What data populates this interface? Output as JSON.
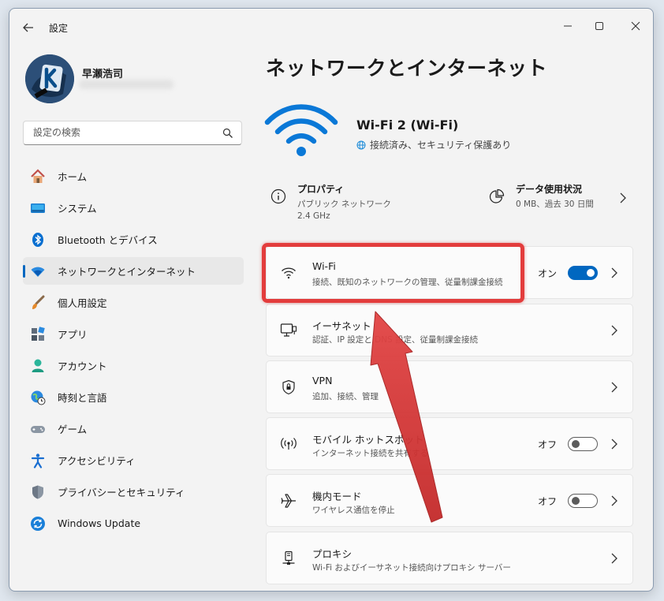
{
  "window": {
    "title": "設定"
  },
  "user": {
    "name": "早瀬浩司"
  },
  "search": {
    "placeholder": "設定の検索"
  },
  "sidebar": {
    "items": [
      {
        "label": "ホーム",
        "icon": "home-icon"
      },
      {
        "label": "システム",
        "icon": "system-icon"
      },
      {
        "label": "Bluetooth とデバイス",
        "icon": "bluetooth-icon"
      },
      {
        "label": "ネットワークとインターネット",
        "icon": "network-icon",
        "active": true
      },
      {
        "label": "個人用設定",
        "icon": "brush-icon"
      },
      {
        "label": "アプリ",
        "icon": "apps-icon"
      },
      {
        "label": "アカウント",
        "icon": "account-icon"
      },
      {
        "label": "時刻と言語",
        "icon": "time-language-icon"
      },
      {
        "label": "ゲーム",
        "icon": "gamepad-icon"
      },
      {
        "label": "アクセシビリティ",
        "icon": "accessibility-icon"
      },
      {
        "label": "プライバシーとセキュリティ",
        "icon": "shield-icon"
      },
      {
        "label": "Windows Update",
        "icon": "update-icon"
      }
    ]
  },
  "main": {
    "title": "ネットワークとインターネット",
    "connection": {
      "name": "Wi-Fi 2 (Wi-Fi)",
      "status": "接続済み、セキュリティ保護あり"
    },
    "properties": {
      "title": "プロパティ",
      "line1": "パブリック ネットワーク",
      "line2": "2.4 GHz"
    },
    "data_usage": {
      "title": "データ使用状況",
      "detail": "0 MB、過去 30 日間"
    },
    "cards": [
      {
        "title": "Wi-Fi",
        "sub": "接続、既知のネットワークの管理、従量制課金接続",
        "state": "オン",
        "toggle": "on",
        "icon": "wifi-icon"
      },
      {
        "title": "イーサネット",
        "sub": "認証、IP 設定と DNS 設定、従量制課金接続",
        "icon": "ethernet-icon"
      },
      {
        "title": "VPN",
        "sub": "追加、接続、管理",
        "icon": "vpn-shield-icon"
      },
      {
        "title": "モバイル ホットスポット",
        "sub": "インターネット接続を共有する",
        "state": "オフ",
        "toggle": "off",
        "icon": "hotspot-icon"
      },
      {
        "title": "機内モード",
        "sub": "ワイヤレス通信を停止",
        "state": "オフ",
        "toggle": "off",
        "icon": "airplane-icon"
      },
      {
        "title": "プロキシ",
        "sub": "Wi-Fi およびイーサネット接続向けプロキシ サーバー",
        "icon": "proxy-icon"
      }
    ]
  },
  "colors": {
    "accent": "#0067c0",
    "highlight": "#e33c3c",
    "background": "#f3f3f3"
  }
}
